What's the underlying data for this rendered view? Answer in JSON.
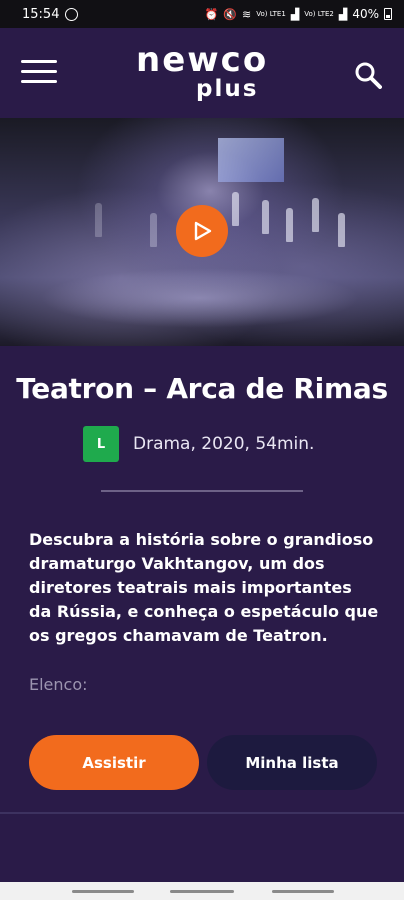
{
  "status_bar": {
    "time": "15:54",
    "battery": "40%",
    "net_label_1": "Vo) LTE1",
    "net_label_2": "Vo) LTE2",
    "icons": [
      "whatsapp-icon",
      "alarm-icon",
      "mute-icon",
      "wifi-icon",
      "signal-icon",
      "battery-icon"
    ]
  },
  "header": {
    "logo_main": "newco",
    "logo_sub": "plus",
    "menu_icon": "hamburger-menu-icon",
    "search_icon": "search-icon"
  },
  "hero": {
    "play_icon": "play-icon",
    "accent": "#f26b1d"
  },
  "content": {
    "title": "Teatron – Arca de Rimas",
    "rating": "L",
    "rating_color": "#1faa4d",
    "meta": "Drama, 2020, 54min.",
    "description": "Descubra a história sobre o grandioso dramaturgo Vakhtangov, um dos diretores teatrais mais importantes da Rússia, e conheça o espetáculo que os gregos chamavam de Teatron.",
    "cast_label": "Elenco:"
  },
  "actions": {
    "watch_label": "Assistir",
    "mylist_label": "Minha lista"
  },
  "colors": {
    "background": "#2a1b48",
    "primary_button": "#f26b1d",
    "secondary_button": "#1d1a3f"
  }
}
